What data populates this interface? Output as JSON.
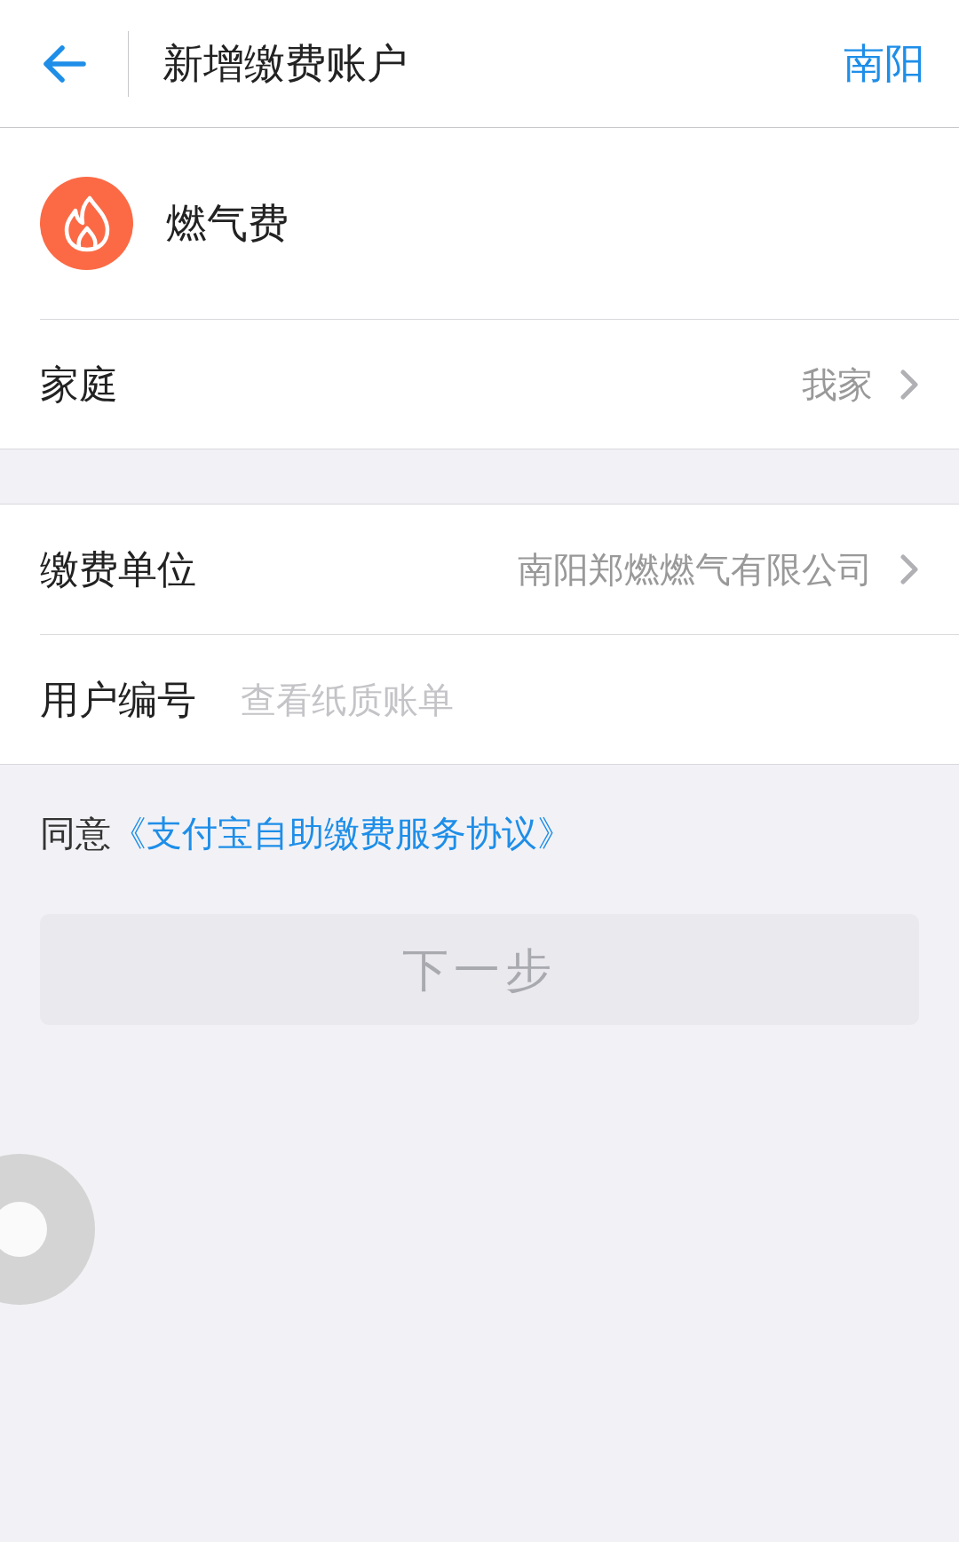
{
  "header": {
    "title": "新增缴费账户",
    "city": "南阳"
  },
  "service": {
    "name": "燃气费"
  },
  "groups": [
    [
      {
        "kind": "select",
        "label": "家庭",
        "value": "我家"
      }
    ],
    [
      {
        "kind": "select",
        "label": "缴费单位",
        "value": "南阳郑燃燃气有限公司"
      },
      {
        "kind": "input",
        "label": "用户编号",
        "placeholder": "查看纸质账单"
      }
    ]
  ],
  "agreement": {
    "prefix": "同意",
    "link": "《支付宝自助缴费服务协议》"
  },
  "next_button": {
    "label": "下一步",
    "disabled": true
  }
}
